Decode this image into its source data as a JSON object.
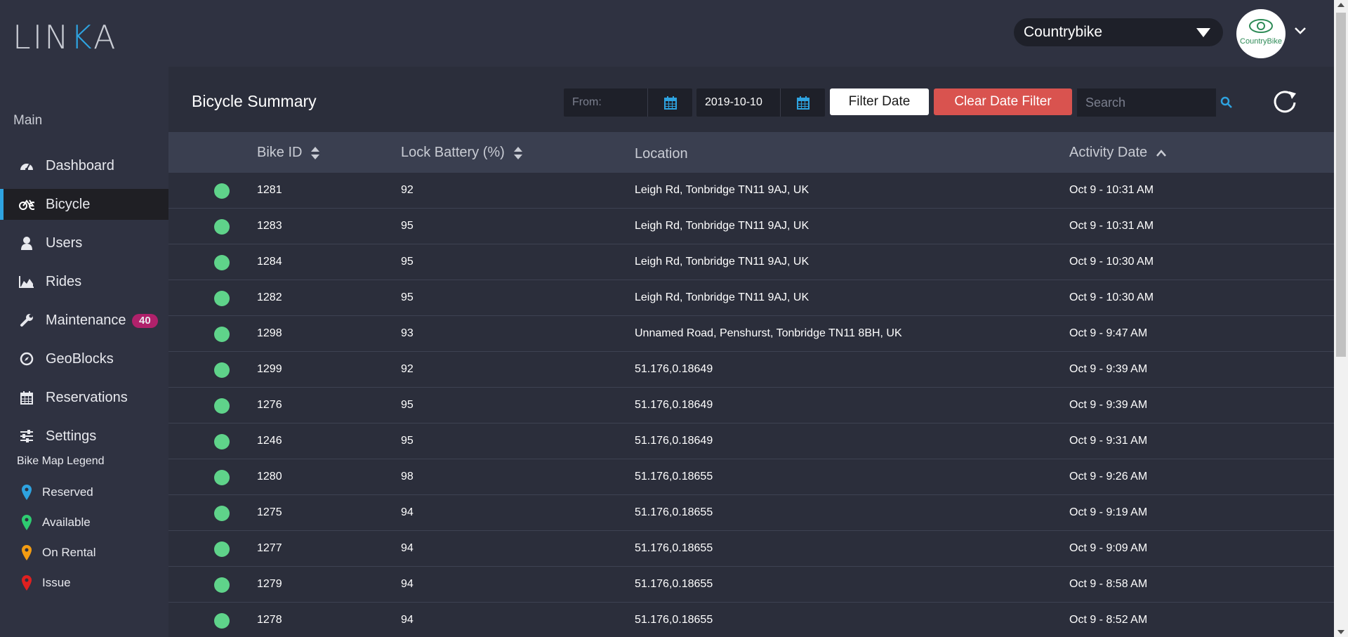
{
  "header": {
    "logo_text_a": "LIN",
    "logo_text_k": "K",
    "logo_text_b": "A",
    "company": "Countrybike",
    "avatar_label": "CountryBike"
  },
  "sidebar": {
    "section_label": "Main",
    "items": [
      {
        "label": "Dashboard",
        "icon": "dashboard-icon"
      },
      {
        "label": "Bicycle",
        "icon": "bicycle-icon",
        "active": true
      },
      {
        "label": "Users",
        "icon": "user-icon"
      },
      {
        "label": "Rides",
        "icon": "area-chart-icon"
      },
      {
        "label": "Maintenance",
        "icon": "wrench-icon",
        "badge": "40"
      },
      {
        "label": "GeoBlocks",
        "icon": "compass-icon"
      },
      {
        "label": "Reservations",
        "icon": "calendar-icon"
      },
      {
        "label": "Settings",
        "icon": "sliders-icon"
      }
    ],
    "legend_title": "Bike Map Legend",
    "legend": [
      {
        "label": "Reserved",
        "color": "#2ea3e0"
      },
      {
        "label": "Available",
        "color": "#2ecc71"
      },
      {
        "label": "On Rental",
        "color": "#f39c12"
      },
      {
        "label": "Issue",
        "color": "#e02020"
      }
    ]
  },
  "main": {
    "title": "Bicycle Summary",
    "from_placeholder": "From:",
    "to_value": "2019-10-10",
    "filter_label": "Filter Date",
    "clear_label": "Clear Date Filter",
    "search_placeholder": "Search"
  },
  "table": {
    "columns": [
      "Bike ID",
      "Lock Battery (%)",
      "Location",
      "Activity Date"
    ],
    "status_color": "#5fd38a",
    "rows": [
      {
        "id": "1281",
        "battery": "92",
        "location": "Leigh Rd, Tonbridge TN11 9AJ, UK",
        "date": "Oct 9 - 10:31 AM"
      },
      {
        "id": "1283",
        "battery": "95",
        "location": "Leigh Rd, Tonbridge TN11 9AJ, UK",
        "date": "Oct 9 - 10:31 AM"
      },
      {
        "id": "1284",
        "battery": "95",
        "location": "Leigh Rd, Tonbridge TN11 9AJ, UK",
        "date": "Oct 9 - 10:30 AM"
      },
      {
        "id": "1282",
        "battery": "95",
        "location": "Leigh Rd, Tonbridge TN11 9AJ, UK",
        "date": "Oct 9 - 10:30 AM"
      },
      {
        "id": "1298",
        "battery": "93",
        "location": "Unnamed Road, Penshurst, Tonbridge TN11 8BH, UK",
        "date": "Oct 9 - 9:47 AM"
      },
      {
        "id": "1299",
        "battery": "92",
        "location": "51.176,0.18649",
        "date": "Oct 9 - 9:39 AM"
      },
      {
        "id": "1276",
        "battery": "95",
        "location": "51.176,0.18649",
        "date": "Oct 9 - 9:39 AM"
      },
      {
        "id": "1246",
        "battery": "95",
        "location": "51.176,0.18649",
        "date": "Oct 9 - 9:31 AM"
      },
      {
        "id": "1280",
        "battery": "98",
        "location": "51.176,0.18655",
        "date": "Oct 9 - 9:26 AM"
      },
      {
        "id": "1275",
        "battery": "94",
        "location": "51.176,0.18655",
        "date": "Oct 9 - 9:19 AM"
      },
      {
        "id": "1277",
        "battery": "94",
        "location": "51.176,0.18655",
        "date": "Oct 9 - 9:09 AM"
      },
      {
        "id": "1279",
        "battery": "94",
        "location": "51.176,0.18655",
        "date": "Oct 9 - 8:58 AM"
      },
      {
        "id": "1278",
        "battery": "94",
        "location": "51.176,0.18655",
        "date": "Oct 9 - 8:52 AM"
      }
    ]
  }
}
